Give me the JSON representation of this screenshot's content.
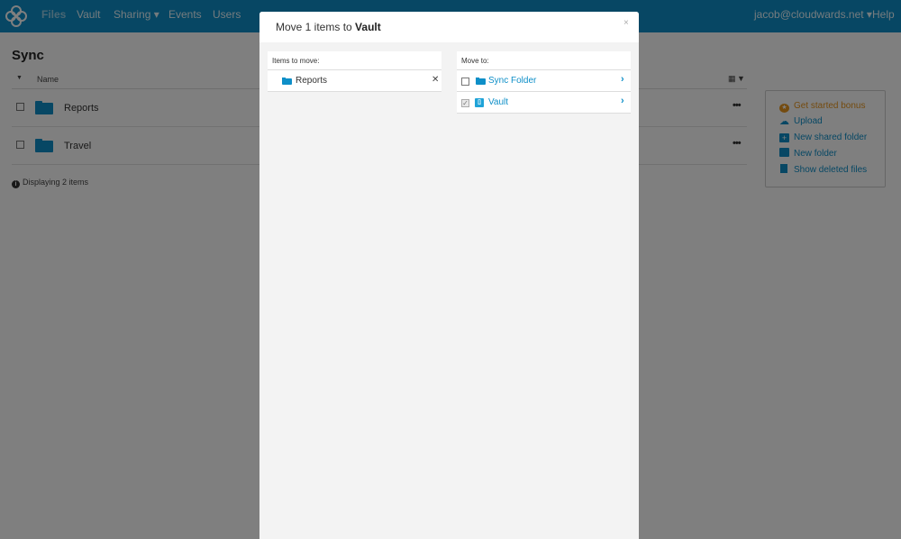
{
  "nav": {
    "items": [
      "Files",
      "Vault",
      "Sharing ▾",
      "Events",
      "Users"
    ],
    "user": "jacob@cloudwards.net ▾",
    "help": "Help"
  },
  "page": {
    "title": "Sync",
    "column_name": "Name",
    "rows": [
      "Reports",
      "Travel"
    ],
    "status": "Displaying 2 items"
  },
  "side_panel": {
    "items": [
      "Get started bonus",
      "Upload",
      "New shared folder",
      "New folder",
      "Show deleted files"
    ]
  },
  "modal": {
    "title_prefix": "Move 1 items to",
    "title_target": "Vault",
    "close": "×",
    "items_header": "Items to move:",
    "items": [
      "Reports"
    ],
    "remove_glyph": "✕",
    "moveto_header": "Move to:",
    "destinations": [
      {
        "label": "Sync Folder",
        "checked": false
      },
      {
        "label": "Vault",
        "checked": true
      }
    ]
  },
  "colors": {
    "accent": "#0e8fc8",
    "bonus": "#e8961e"
  }
}
